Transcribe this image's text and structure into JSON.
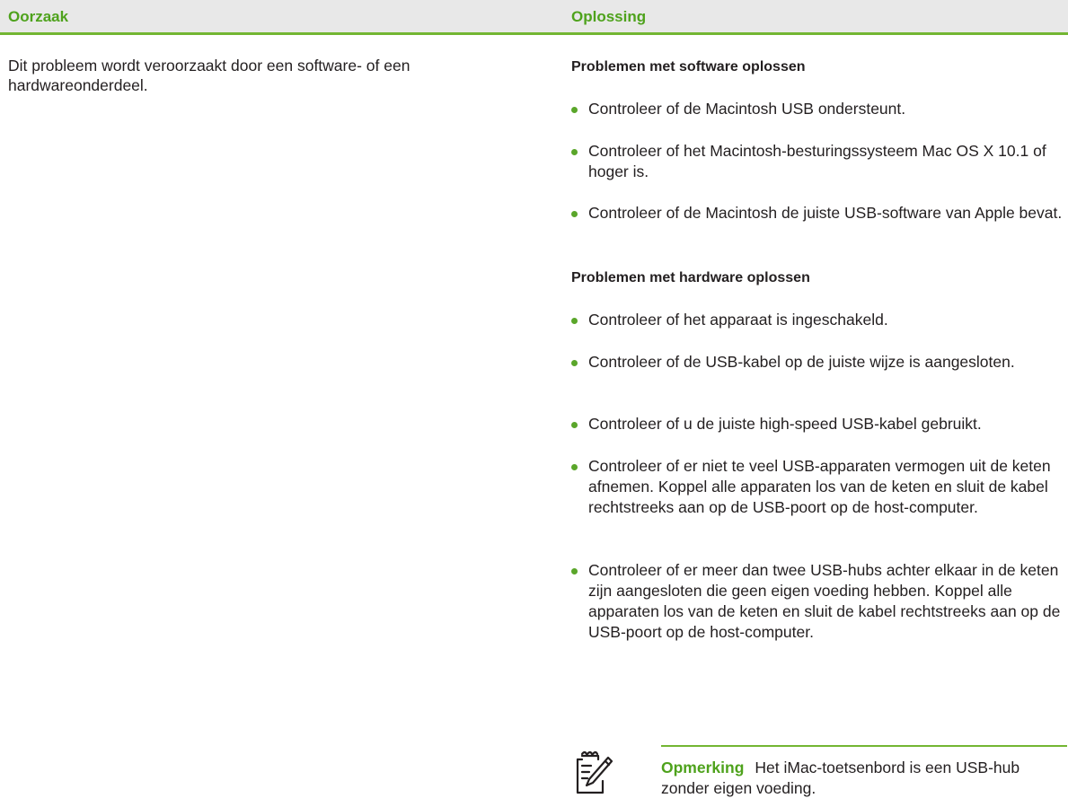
{
  "header": {
    "cause_label": "Oorzaak",
    "solution_label": "Oplossing"
  },
  "cause": {
    "text": "Dit probleem wordt veroorzaakt door een software- of een hardwareonderdeel."
  },
  "solution": {
    "software": {
      "heading": "Problemen met software oplossen",
      "items": [
        "Controleer of de Macintosh USB ondersteunt.",
        "Controleer of het Macintosh-besturingssysteem Mac OS X 10.1 of hoger is.",
        "Controleer of de Macintosh de juiste USB-software van Apple bevat."
      ]
    },
    "hardware": {
      "heading": "Problemen met hardware oplossen",
      "items": [
        "Controleer of het apparaat is ingeschakeld.",
        "Controleer of de USB-kabel op de juiste wijze is aangesloten.",
        "Controleer of u de juiste high-speed USB-kabel gebruikt.",
        "Controleer of er niet te veel USB-apparaten vermogen uit de keten afnemen. Koppel alle apparaten los van de keten en sluit de kabel rechtstreeks aan op de USB-poort op de host-computer.",
        "Controleer of er meer dan twee USB-hubs achter elkaar in de keten zijn aangesloten die geen eigen voeding hebben. Koppel alle apparaten los van de keten en sluit de kabel rechtstreeks aan op de USB-poort op de host-computer."
      ]
    },
    "note": {
      "icon": "note-pencil-icon",
      "label": "Opmerking",
      "text": "Het iMac-toetsenbord is een USB-hub zonder eigen voeding."
    }
  },
  "colors": {
    "accent_green": "#4ea21c",
    "rule_green": "#73b632",
    "header_bg": "#e8e8e8"
  }
}
